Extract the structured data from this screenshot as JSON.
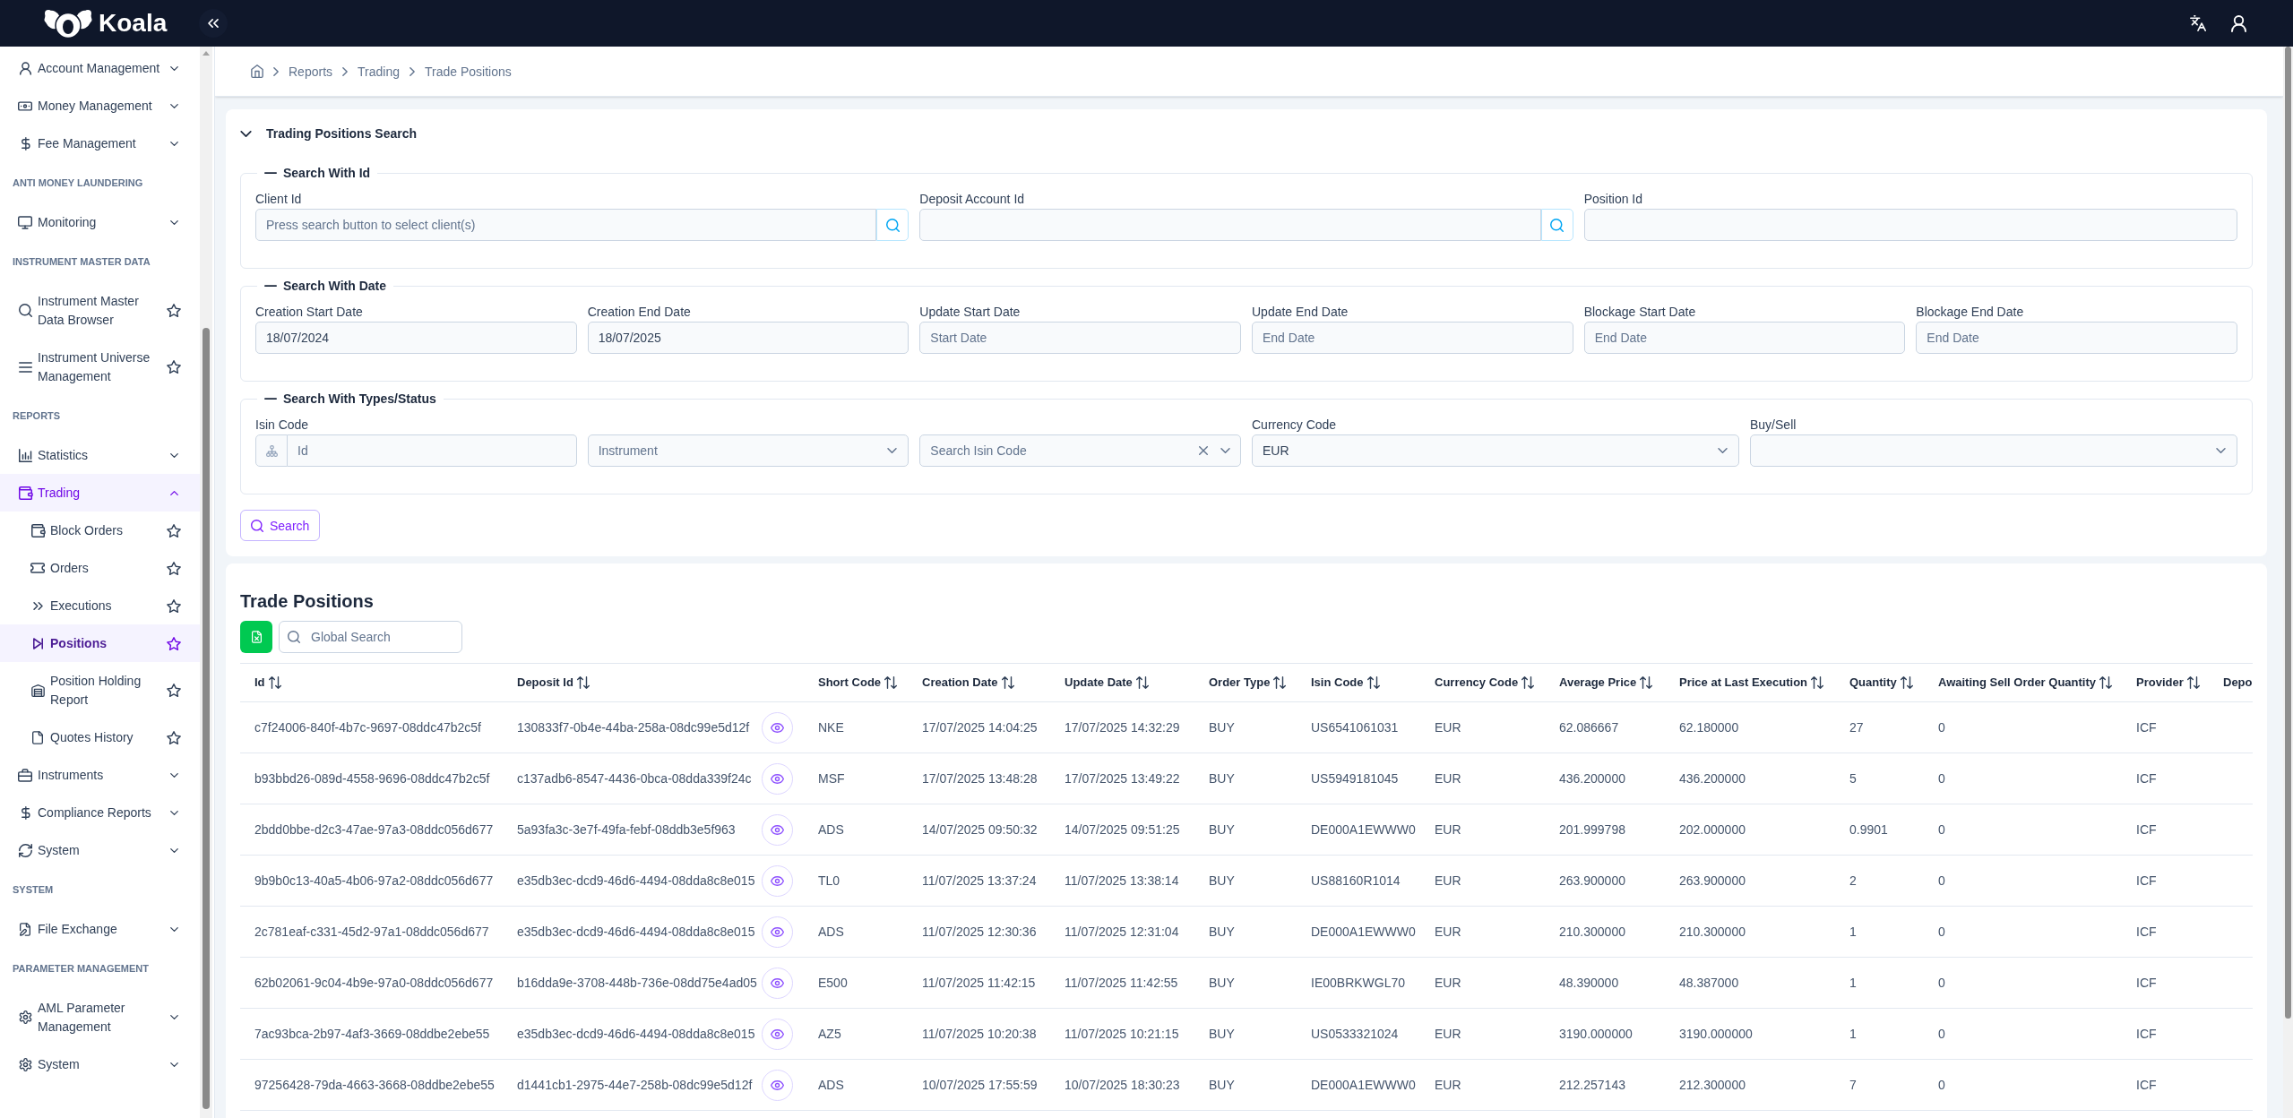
{
  "topbar": {
    "logo": "Koala"
  },
  "sidebar": {
    "items": [
      {
        "kind": "group",
        "label": "Account Management",
        "expanded": false,
        "selected": false
      },
      {
        "kind": "group",
        "label": "Money Management",
        "expanded": false,
        "selected": false
      },
      {
        "kind": "group",
        "label": "Fee Management",
        "expanded": false,
        "selected": false
      },
      {
        "kind": "section",
        "label": "ANTI MONEY LAUNDERING"
      },
      {
        "kind": "group",
        "label": "Monitoring",
        "expanded": false,
        "selected": false
      },
      {
        "kind": "section",
        "label": "INSTRUMENT MASTER DATA"
      },
      {
        "kind": "link",
        "label": "Instrument Master Data Browser",
        "selected": false
      },
      {
        "kind": "link",
        "label": "Instrument Universe Management",
        "selected": false
      },
      {
        "kind": "section",
        "label": "REPORTS"
      },
      {
        "kind": "group",
        "label": "Statistics",
        "expanded": false,
        "selected": false
      },
      {
        "kind": "group",
        "label": "Trading",
        "expanded": true,
        "selected": true,
        "children": [
          {
            "kind": "link",
            "label": "Block Orders",
            "selected": false
          },
          {
            "kind": "link",
            "label": "Orders",
            "selected": false
          },
          {
            "kind": "link",
            "label": "Executions",
            "selected": false
          },
          {
            "kind": "link",
            "label": "Positions",
            "selected": true
          },
          {
            "kind": "link",
            "label": "Position Holding Report",
            "selected": false
          },
          {
            "kind": "link",
            "label": "Quotes History",
            "selected": false
          }
        ]
      },
      {
        "kind": "group",
        "label": "Instruments",
        "expanded": false,
        "selected": false
      },
      {
        "kind": "group",
        "label": "Compliance Reports",
        "expanded": false,
        "selected": false
      },
      {
        "kind": "group",
        "label": "System",
        "expanded": false,
        "selected": false
      },
      {
        "kind": "section",
        "label": "SYSTEM"
      },
      {
        "kind": "group",
        "label": "File Exchange",
        "expanded": false,
        "selected": false
      },
      {
        "kind": "section",
        "label": "PARAMETER MANAGEMENT"
      },
      {
        "kind": "group",
        "label": "AML Parameter Management",
        "expanded": false,
        "selected": false
      },
      {
        "kind": "group",
        "label": "System",
        "expanded": false,
        "selected": false
      }
    ]
  },
  "breadcrumb": [
    "Reports",
    "Trading",
    "Trade Positions"
  ],
  "search_panel": {
    "title": "Trading Positions Search",
    "expanded": true,
    "groups": [
      {
        "legend": "Search With Id",
        "expanded": true,
        "fields": [
          {
            "kind": "lookup",
            "label": "Client Id",
            "placeholder": "Press search button to select client(s)"
          },
          {
            "kind": "lookup",
            "label": "Deposit Account Id"
          },
          {
            "kind": "text",
            "label": "Position Id"
          }
        ]
      },
      {
        "legend": "Search With Date",
        "expanded": true,
        "fields": [
          {
            "kind": "text",
            "label": "Creation Start Date",
            "value": "18/07/2024"
          },
          {
            "kind": "text",
            "label": "Creation End Date",
            "value": "18/07/2025"
          },
          {
            "kind": "text",
            "label": "Update Start Date",
            "placeholder": "Start Date"
          },
          {
            "kind": "text",
            "label": "Update End Date",
            "placeholder": "End Date"
          },
          {
            "kind": "text",
            "label": "Blockage Start Date",
            "placeholder": "End Date"
          },
          {
            "kind": "text",
            "label": "Blockage End Date",
            "placeholder": "End Date"
          }
        ]
      },
      {
        "legend": "Search With Types/Status",
        "expanded": true,
        "fields": [
          {
            "kind": "addon",
            "label": "Isin Code",
            "placeholder": "Id"
          },
          {
            "kind": "select",
            "placeholder": "Instrument"
          },
          {
            "kind": "combo",
            "placeholder": "Search Isin Code",
            "clearable": true
          },
          {
            "kind": "select",
            "label": "Currency Code",
            "value": "EUR"
          },
          {
            "kind": "select",
            "label": "Buy/Sell"
          }
        ]
      }
    ],
    "button": "Search"
  },
  "table": {
    "title": "Trade Positions",
    "search": {
      "placeholder": "Global Search"
    },
    "columns": [
      {
        "label": "Id",
        "kind": "text",
        "sortable": true
      },
      {
        "label": "Deposit Id",
        "kind": "view",
        "sortable": true
      },
      {
        "label": "Short Code",
        "kind": "text",
        "sortable": true
      },
      {
        "label": "Creation Date",
        "kind": "text",
        "sortable": true
      },
      {
        "label": "Update Date",
        "kind": "text",
        "sortable": true
      },
      {
        "label": "Order Type",
        "kind": "text",
        "sortable": true
      },
      {
        "label": "Isin Code",
        "kind": "text",
        "sortable": true
      },
      {
        "label": "Currency Code",
        "kind": "text",
        "sortable": true
      },
      {
        "label": "Average Price",
        "kind": "text",
        "sortable": true
      },
      {
        "label": "Price at Last Execution",
        "kind": "text",
        "sortable": true
      },
      {
        "label": "Quantity",
        "kind": "text",
        "sortable": true
      },
      {
        "label": "Awaiting Sell Order Quantity",
        "kind": "text",
        "sortable": true
      },
      {
        "label": "Provider",
        "kind": "text",
        "sortable": true
      },
      {
        "label": "Depo"
      }
    ],
    "rows": [
      [
        "c7f24006-840f-4b7c-9697-08ddc47b2c5f",
        "130833f7-0b4e-44ba-258a-08dc99e5d12f",
        "NKE",
        "17/07/2025 14:04:25",
        "17/07/2025 14:32:29",
        "BUY",
        "US6541061031",
        "EUR",
        "62.086667",
        "62.180000",
        "27",
        "0",
        "ICF"
      ],
      [
        "b93bbd26-089d-4558-9696-08ddc47b2c5f",
        "c137adb6-8547-4436-0bca-08dda339f24c",
        "MSF",
        "17/07/2025 13:48:28",
        "17/07/2025 13:49:22",
        "BUY",
        "US5949181045",
        "EUR",
        "436.200000",
        "436.200000",
        "5",
        "0",
        "ICF"
      ],
      [
        "2bdd0bbe-d2c3-47ae-97a3-08ddc056d677",
        "5a93fa3c-3e7f-49fa-febf-08ddb3e5f963",
        "ADS",
        "14/07/2025 09:50:32",
        "14/07/2025 09:51:25",
        "BUY",
        "DE000A1EWWW0",
        "EUR",
        "201.999798",
        "202.000000",
        "0.9901",
        "0",
        "ICF"
      ],
      [
        "9b9b0c13-40a5-4b06-97a2-08ddc056d677",
        "e35db3ec-dcd9-46d6-4494-08dda8c8e015",
        "TL0",
        "11/07/2025 13:37:24",
        "11/07/2025 13:38:14",
        "BUY",
        "US88160R1014",
        "EUR",
        "263.900000",
        "263.900000",
        "2",
        "0",
        "ICF"
      ],
      [
        "2c781eaf-c331-45d2-97a1-08ddc056d677",
        "e35db3ec-dcd9-46d6-4494-08dda8c8e015",
        "ADS",
        "11/07/2025 12:30:36",
        "11/07/2025 12:31:04",
        "BUY",
        "DE000A1EWWW0",
        "EUR",
        "210.300000",
        "210.300000",
        "1",
        "0",
        "ICF"
      ],
      [
        "62b02061-9c04-4b9e-97a0-08ddc056d677",
        "b16dda9e-3708-448b-736e-08dd75e4ad05",
        "E500",
        "11/07/2025 11:42:15",
        "11/07/2025 11:42:55",
        "BUY",
        "IE00BRKWGL70",
        "EUR",
        "48.390000",
        "48.387000",
        "1",
        "0",
        "ICF"
      ],
      [
        "7ac93bca-2b97-4af3-3669-08ddbe2ebe55",
        "e35db3ec-dcd9-46d6-4494-08dda8c8e015",
        "AZ5",
        "11/07/2025 10:20:38",
        "11/07/2025 10:21:15",
        "BUY",
        "US0533321024",
        "EUR",
        "3190.000000",
        "3190.000000",
        "1",
        "0",
        "ICF"
      ],
      [
        "97256428-79da-4663-3668-08ddbe2ebe55",
        "d1441cb1-2975-44e7-258b-08dc99e5d12f",
        "ADS",
        "10/07/2025 17:55:59",
        "10/07/2025 18:30:23",
        "BUY",
        "DE000A1EWWW0",
        "EUR",
        "212.257143",
        "212.300000",
        "7",
        "0",
        "ICF"
      ]
    ]
  }
}
